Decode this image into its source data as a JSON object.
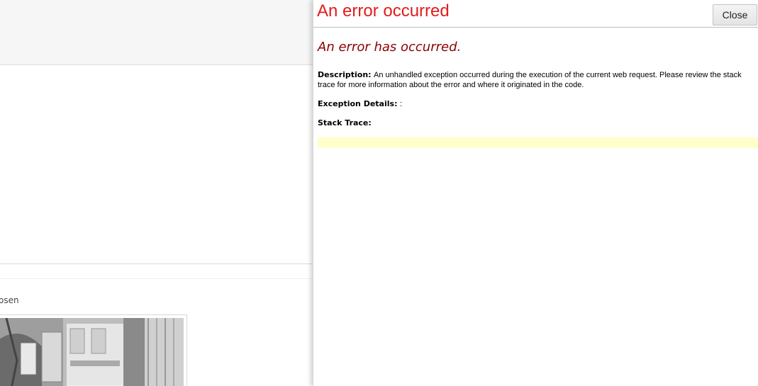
{
  "background_page": {
    "caption_fragment": "osen"
  },
  "error_panel": {
    "title": "An error occurred",
    "close_label": "Close",
    "heading": "An error has occurred.",
    "description_label": "Description:",
    "description_text": "An unhandled exception occurred during the execution of the current web request. Please review the stack trace for more information about the error and where it originated in the code.",
    "exception_label": "Exception Details:",
    "exception_text": ":",
    "stack_trace_label": "Stack Trace:",
    "stack_trace_text": ""
  },
  "colors": {
    "title": "#e31b1b",
    "heading": "#8b0000",
    "trace_background": "#ffffcc"
  }
}
